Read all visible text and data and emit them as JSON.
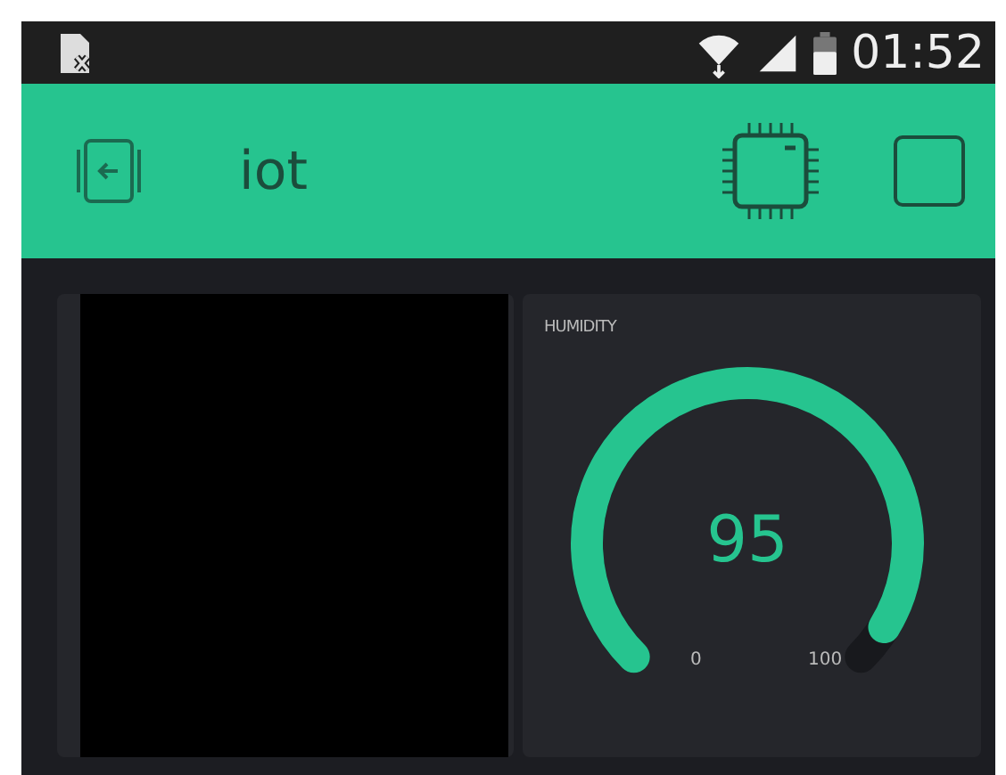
{
  "status_bar": {
    "time": "01:52"
  },
  "app_bar": {
    "title": "iot"
  },
  "gauge": {
    "label": "HUMIDITY",
    "value": "95",
    "min": "0",
    "max": "100"
  }
}
